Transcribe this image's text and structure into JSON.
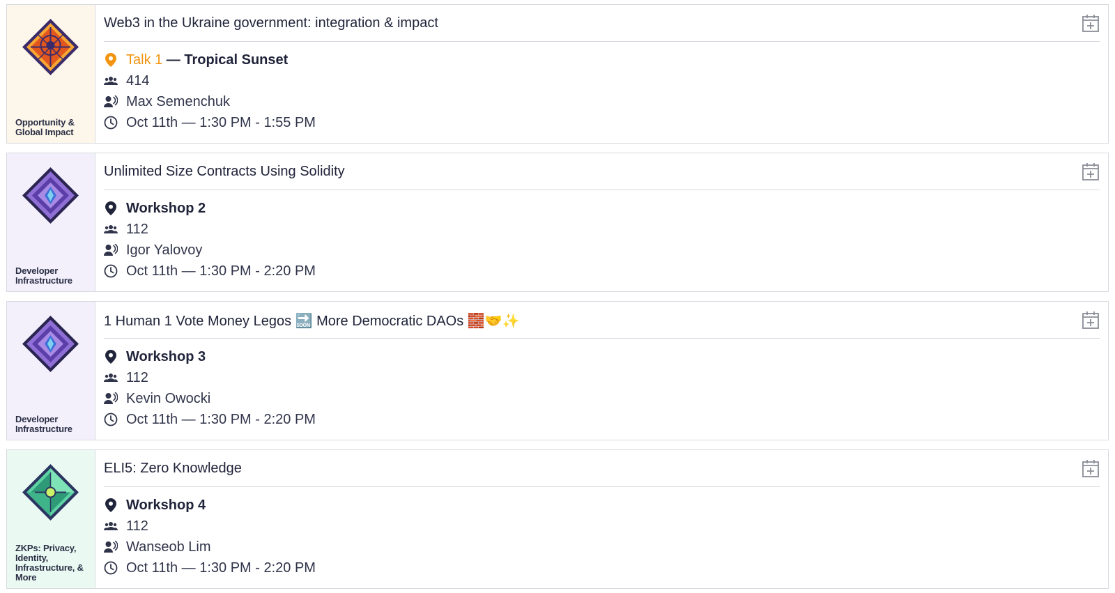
{
  "sessions": [
    {
      "track": "Opportunity & Global Impact",
      "track_bg": "#fdf6ea",
      "badge_colors": [
        "#f7a633",
        "#e2571e",
        "#3b2b6b"
      ],
      "title": "Web3 in the Ukraine government: integration & impact",
      "room_link": "Talk 1",
      "room_rest": " — Tropical Sunset",
      "room_color": "#f2940f",
      "attendees": "414",
      "speaker": "Max Semenchuk",
      "time": "Oct 11th — 1:30 PM - 1:55 PM"
    },
    {
      "track": "Developer Infrastructure",
      "track_bg": "#f3f0fc",
      "badge_colors": [
        "#8f6fd6",
        "#5b3ea8",
        "#2a2550"
      ],
      "title": "Unlimited Size Contracts Using Solidity",
      "room": "Workshop 2",
      "room_color": "#20243a",
      "attendees": "112",
      "speaker": "Igor Yalovoy",
      "time": "Oct 11th — 1:30 PM - 2:20 PM"
    },
    {
      "track": "Developer Infrastructure",
      "track_bg": "#f3f0fc",
      "badge_colors": [
        "#8f6fd6",
        "#5b3ea8",
        "#2a2550"
      ],
      "title": "1 Human 1 Vote Money Legos 🔜 More Democratic DAOs 🧱🤝✨",
      "room": "Workshop 3",
      "room_color": "#20243a",
      "attendees": "112",
      "speaker": "Kevin Owocki",
      "time": "Oct 11th — 1:30 PM - 2:20 PM"
    },
    {
      "track": "ZKPs: Privacy, Identity, Infrastructure, & More",
      "track_bg": "#eafaf3",
      "badge_colors": [
        "#5dd3a3",
        "#2f9a78",
        "#2a3560"
      ],
      "title": "ELI5: Zero Knowledge",
      "room": "Workshop 4",
      "room_color": "#20243a",
      "attendees": "112",
      "speaker": "Wanseob Lim",
      "time": "Oct 11th — 1:30 PM - 2:20 PM"
    }
  ],
  "icons": {
    "room": "map-pin-icon",
    "attendees": "group-icon",
    "speaker": "speaker-icon",
    "time": "clock-icon",
    "add": "calendar-add-icon"
  }
}
